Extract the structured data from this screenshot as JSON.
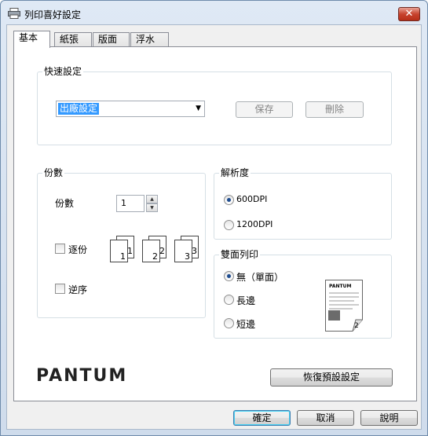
{
  "window": {
    "title": "列印喜好設定",
    "close_label": "✕"
  },
  "tabs": [
    {
      "label": "基本",
      "active": true
    },
    {
      "label": "紙張",
      "active": false
    },
    {
      "label": "版面",
      "active": false
    },
    {
      "label": "浮水印",
      "active": false
    }
  ],
  "quick_settings": {
    "legend": "快速設定",
    "selected": "出廠設定",
    "save_label": "保存",
    "delete_label": "刪除"
  },
  "copies": {
    "legend": "份數",
    "copies_label": "份數",
    "copies_value": "1",
    "collate_label": "逐份",
    "collate_checked": false,
    "reverse_label": "逆序",
    "reverse_checked": false,
    "collate_page_numbers": [
      "1",
      "2",
      "3"
    ]
  },
  "resolution": {
    "legend": "解析度",
    "options": [
      {
        "label": "600DPI",
        "checked": true
      },
      {
        "label": "1200DPI",
        "checked": false
      }
    ]
  },
  "duplex": {
    "legend": "雙面列印",
    "options": [
      {
        "label": "無（單面）",
        "checked": true
      },
      {
        "label": "長邊",
        "checked": false
      },
      {
        "label": "短邊",
        "checked": false
      }
    ],
    "preview_logo": "PANTUM",
    "preview_page_number": "2"
  },
  "brand": {
    "logo": "PANTUM"
  },
  "restore_defaults_label": "恢復預設設定",
  "footer": {
    "ok_label": "確定",
    "cancel_label": "取消",
    "help_label": "說明"
  },
  "colors": {
    "accent": "#3399ff",
    "close": "#c7432e"
  }
}
